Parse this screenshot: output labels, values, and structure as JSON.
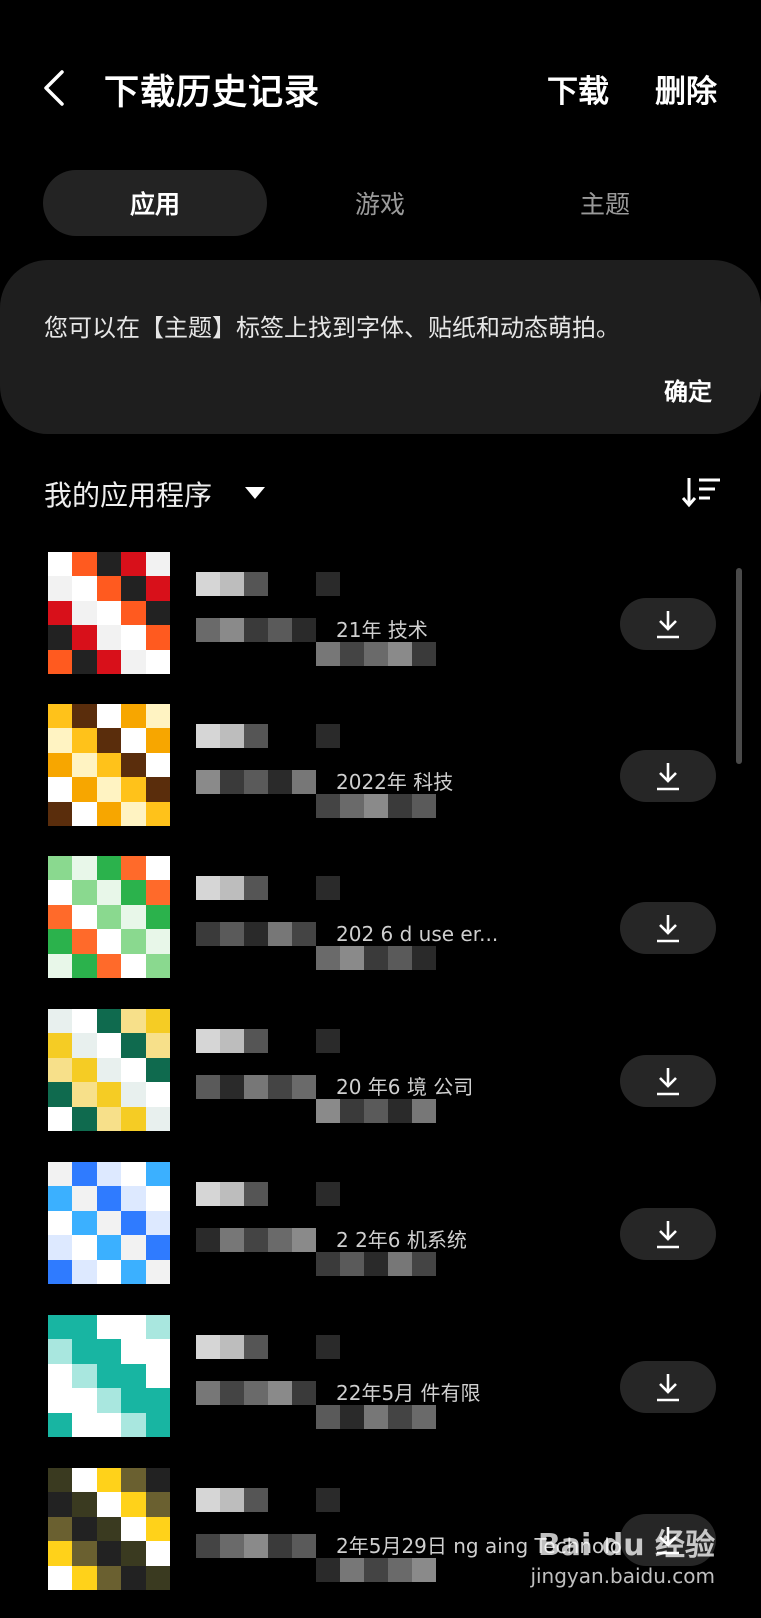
{
  "header": {
    "title": "下载历史记录",
    "download_label": "下载",
    "delete_label": "删除"
  },
  "tabs": [
    {
      "label": "应用",
      "active": true
    },
    {
      "label": "游戏",
      "active": false
    },
    {
      "label": "主题",
      "active": false
    }
  ],
  "notice": {
    "text": "您可以在【主题】标签上找到字体、贴纸和动态萌拍。",
    "ok_label": "确定"
  },
  "section": {
    "title": "我的应用程序"
  },
  "apps": [
    {
      "visible_text": "21年 技术"
    },
    {
      "visible_text": "2022年 科技"
    },
    {
      "visible_text": "202 6 d use er..."
    },
    {
      "visible_text": "20 年6 境 公司"
    },
    {
      "visible_text": "2 2年6 机系统"
    },
    {
      "visible_text": "22年5月 件有限"
    },
    {
      "visible_text": "2年5月29日 ng aing Technolo ., Ltd."
    }
  ],
  "watermark": {
    "brand": "Bai du 经验",
    "url": "jingyan.baidu.com"
  },
  "colors": {
    "background": "#000000",
    "tab_active_bg": "#232323",
    "notice_bg": "#1e1e1e",
    "download_button_bg": "#262626"
  }
}
